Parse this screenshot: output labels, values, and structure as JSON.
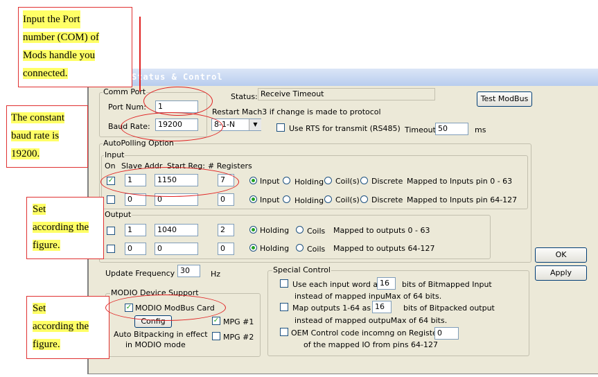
{
  "window": {
    "title": "Status & Control"
  },
  "annotations": {
    "port": [
      "Input the Port",
      "number (COM) of",
      "Mods handle you",
      "connected."
    ],
    "baud": [
      "The constant",
      "baud rate is",
      "19200."
    ],
    "set1": [
      "Set",
      "according the",
      "figure."
    ],
    "set2": [
      "Set",
      "according the",
      "figure."
    ]
  },
  "comm_port": {
    "group_label": "Comm Port",
    "port_label": "Port Num:",
    "port_value": "1",
    "baud_label": "Baud Rate:",
    "baud_value": "19200"
  },
  "status": {
    "label": "Status:",
    "value": "Receive Timeout",
    "restart_note": "Restart Mach3 if change is made to protocol",
    "protocol_value": "8-1-N",
    "rts_label": "Use RTS for transmit (RS485)",
    "rts_checked": false,
    "timeout_label": "Timeout",
    "timeout_value": "50",
    "timeout_unit": "ms"
  },
  "buttons": {
    "test_modbus": "Test ModBus",
    "ok": "OK",
    "apply": "Apply",
    "config": "Config"
  },
  "autopolling": {
    "group_label": "AutoPolling Option",
    "input_label": "Input",
    "col_on": "On",
    "col_slave": "Slave Addr",
    "col_start": "Start Reg:",
    "col_count": "# Registers",
    "radio_input": "Input",
    "radio_holding": "Holding",
    "radio_coils": "Coil(s)",
    "radio_discrete": "Discrete",
    "input_rows": [
      {
        "on": true,
        "slave": "1",
        "start": "1150",
        "count": "7",
        "mapped": "Mapped to Inputs pin 0 - 63"
      },
      {
        "on": false,
        "slave": "0",
        "start": "0",
        "count": "0",
        "mapped": "Mapped to Inputs pin 64-127"
      }
    ],
    "output_label": "Output",
    "out_radio_holding": "Holding",
    "out_radio_coils": "Coils",
    "output_rows": [
      {
        "on": false,
        "slave": "1",
        "start": "1040",
        "count": "2",
        "mapped": "Mapped to outputs 0 - 63"
      },
      {
        "on": false,
        "slave": "0",
        "start": "0",
        "count": "0",
        "mapped": "Mapped to outputs 64-127"
      }
    ]
  },
  "update": {
    "label": "Update Frequency",
    "value": "30",
    "unit": "Hz"
  },
  "modio": {
    "group_label": "MODIO Device Support",
    "card_label": "MODIO ModBus Card",
    "card_checked": true,
    "mpg1_label": "MPG #1",
    "mpg1_checked": true,
    "mpg2_label": "MPG #2",
    "mpg2_checked": false,
    "note_line1": "Auto Bitpacking in effect",
    "note_line2": "in MODIO mode"
  },
  "special": {
    "group_label": "Special Control",
    "opt1_a": "Use each input word as",
    "opt1_value": "16",
    "opt1_b": "bits of Bitmapped Input",
    "opt1_c": "instead of mapped inpuMax of 64 bits.",
    "opt2_a": "Map outputs 1-64 as",
    "opt2_value": "16",
    "opt2_b": "bits of Bitpacked output",
    "opt2_c": "instead of mapped outpuMax of 64 bits.",
    "opt3_a": "OEM Control code incomng on Register #",
    "opt3_value": "0",
    "opt3_b": "of the mapped IO from pins 64-127"
  },
  "colors": {
    "highlight": "#ffff66",
    "annotation_red": "#e02020",
    "dialog_bg": "#ece9d8",
    "check_green": "#21a121"
  }
}
